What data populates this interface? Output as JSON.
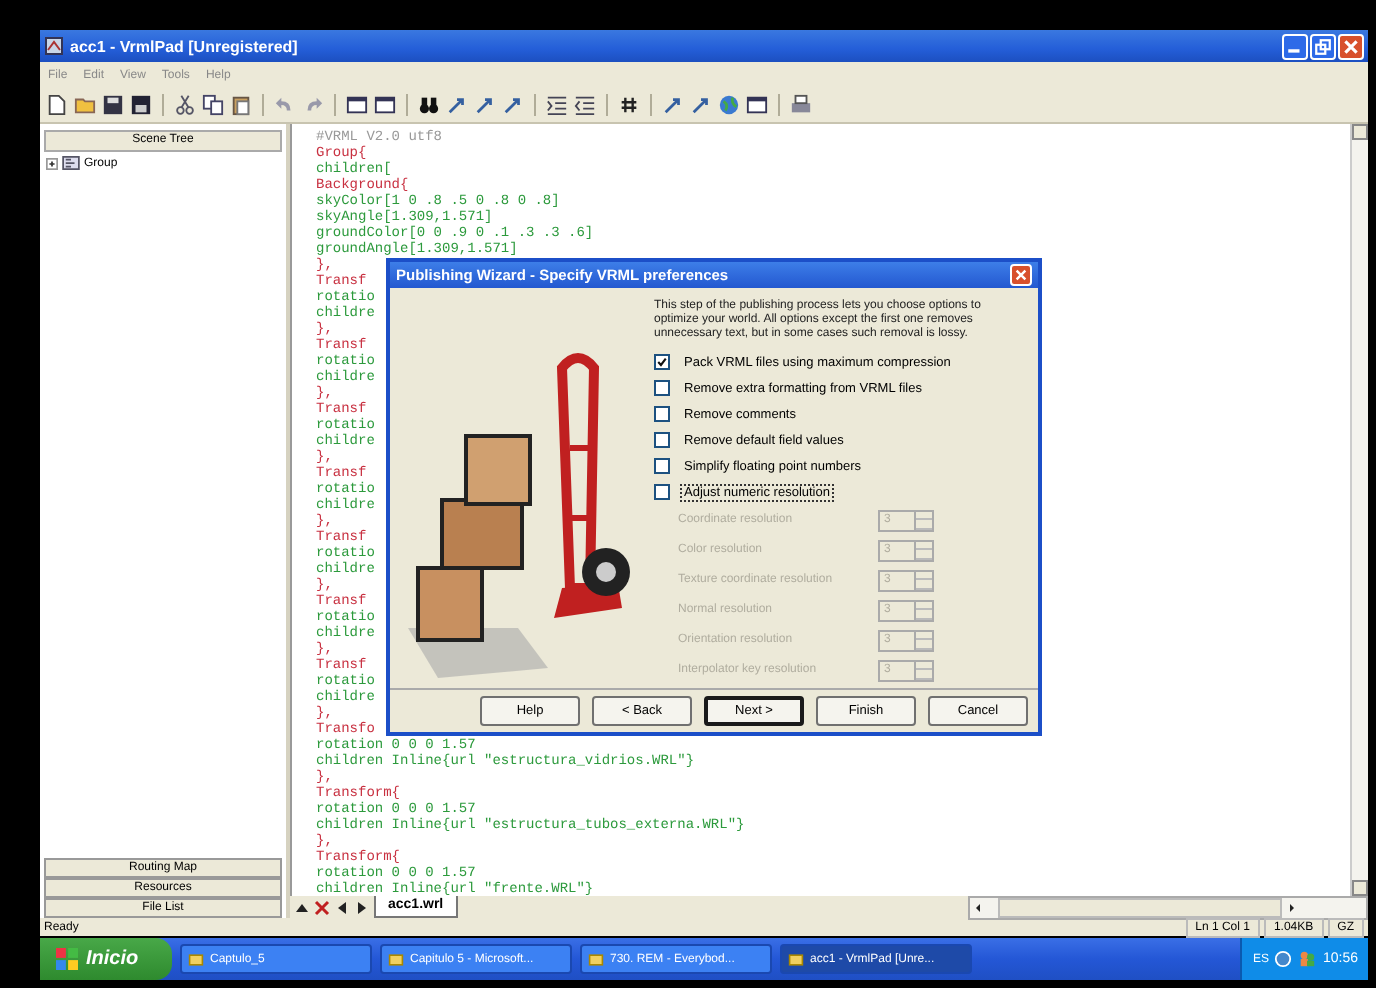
{
  "window": {
    "title": "acc1 - VrmlPad [Unregistered]"
  },
  "menu": [
    "File",
    "Edit",
    "View",
    "Tools",
    "Help"
  ],
  "left_panel": {
    "header": "Scene Tree",
    "tree": [
      {
        "label": "Group",
        "expanded": false
      }
    ],
    "buttons": [
      "Routing Map",
      "Resources",
      "File List"
    ]
  },
  "editor": {
    "lines": [
      {
        "text": "#VRML V2.0 utf8",
        "kind": "comment"
      },
      {
        "text": "Group{",
        "kind": "node"
      },
      {
        "text": "children[",
        "kind": "field"
      },
      {
        "text": "Background{",
        "kind": "node"
      },
      {
        "text": "skyColor[1 0 .8 .5 0 .8 0 .8]",
        "kind": "field"
      },
      {
        "text": "skyAngle[1.309,1.571]",
        "kind": "field"
      },
      {
        "text": "groundColor[0 0 .9 0 .1 .3 .3 .6]",
        "kind": "field"
      },
      {
        "text": "groundAngle[1.309,1.571]",
        "kind": "field"
      },
      {
        "text": "},",
        "kind": "brace"
      },
      {
        "text": "Transf",
        "kind": "node"
      },
      {
        "text": "rotatio",
        "kind": "field"
      },
      {
        "text": "childre",
        "kind": "field"
      },
      {
        "text": "},",
        "kind": "brace"
      },
      {
        "text": "Transf",
        "kind": "node"
      },
      {
        "text": "rotatio",
        "kind": "field"
      },
      {
        "text": "childre",
        "kind": "field"
      },
      {
        "text": "},",
        "kind": "brace"
      },
      {
        "text": "Transf",
        "kind": "node"
      },
      {
        "text": "rotatio",
        "kind": "field"
      },
      {
        "text": "childre",
        "kind": "field"
      },
      {
        "text": "},",
        "kind": "brace"
      },
      {
        "text": "Transf",
        "kind": "node"
      },
      {
        "text": "rotatio",
        "kind": "field"
      },
      {
        "text": "childre",
        "kind": "field"
      },
      {
        "text": "},",
        "kind": "brace"
      },
      {
        "text": "Transf",
        "kind": "node"
      },
      {
        "text": "rotatio",
        "kind": "field"
      },
      {
        "text": "childre",
        "kind": "field"
      },
      {
        "text": "},",
        "kind": "brace"
      },
      {
        "text": "Transf",
        "kind": "node"
      },
      {
        "text": "rotatio",
        "kind": "field"
      },
      {
        "text": "childre",
        "kind": "field"
      },
      {
        "text": "},",
        "kind": "brace"
      },
      {
        "text": "Transf",
        "kind": "node"
      },
      {
        "text": "rotatio",
        "kind": "field"
      },
      {
        "text": "childre",
        "kind": "field"
      },
      {
        "text": "},",
        "kind": "brace"
      },
      {
        "text": "Transfo",
        "kind": "node"
      },
      {
        "text": "rotation 0 0 0 1.57",
        "kind": "field"
      },
      {
        "text": "children Inline{url \"estructura_vidrios.WRL\"}",
        "kind": "field"
      },
      {
        "text": "},",
        "kind": "brace"
      },
      {
        "text": "Transform{",
        "kind": "node"
      },
      {
        "text": "rotation 0 0 0 1.57",
        "kind": "field"
      },
      {
        "text": "children Inline{url \"estructura_tubos_externa.WRL\"}",
        "kind": "field"
      },
      {
        "text": "},",
        "kind": "brace"
      },
      {
        "text": "Transform{",
        "kind": "node"
      },
      {
        "text": "rotation 0 0 0 1.57",
        "kind": "field"
      },
      {
        "text": "children Inline{url \"frente.WRL\"}",
        "kind": "field"
      }
    ],
    "tabs": [
      {
        "label": "acc1.wrl",
        "selected": true
      }
    ]
  },
  "dialog": {
    "title": "Publishing Wizard - Specify VRML preferences",
    "description": "This step of the publishing process lets you choose options to optimize your world.  All options except the first one removes unnecessary text, but in some cases such removal is lossy.",
    "options": [
      {
        "label": "Pack VRML files using maximum compression",
        "checked": true,
        "focused": false
      },
      {
        "label": "Remove extra formatting from VRML files",
        "checked": false,
        "focused": false
      },
      {
        "label": "Remove comments",
        "checked": false,
        "focused": false
      },
      {
        "label": "Remove default field values",
        "checked": false,
        "focused": false
      },
      {
        "label": "Simplify floating point numbers",
        "checked": false,
        "focused": false
      },
      {
        "label": "Adjust numeric resolution",
        "checked": false,
        "focused": true
      }
    ],
    "resolutions": [
      {
        "label": "Coordinate resolution",
        "value": "3",
        "disabled": true
      },
      {
        "label": "Color resolution",
        "value": "3",
        "disabled": true
      },
      {
        "label": "Texture coordinate resolution",
        "value": "3",
        "disabled": true
      },
      {
        "label": "Normal resolution",
        "value": "3",
        "disabled": true
      },
      {
        "label": "Orientation resolution",
        "value": "3",
        "disabled": true
      },
      {
        "label": "Interpolator key resolution",
        "value": "3",
        "disabled": true
      }
    ],
    "buttons": [
      {
        "label": "Help",
        "default": false
      },
      {
        "label": "< Back",
        "default": false
      },
      {
        "label": "Next >",
        "default": true
      },
      {
        "label": "Finish",
        "default": false
      },
      {
        "label": "Cancel",
        "default": false
      }
    ]
  },
  "status_bar": {
    "message": "Ready",
    "panes": [
      "Ln 1 Col 1",
      "1.04KB",
      "GZ"
    ]
  },
  "taskbar": {
    "start": "Inicio",
    "items": [
      {
        "label": "Captulo_5",
        "selected": false
      },
      {
        "label": "Capitulo 5 - Microsoft...",
        "selected": false
      },
      {
        "label": "730. REM - Everybod...",
        "selected": false
      },
      {
        "label": "acc1 - VrmlPad [Unre...",
        "selected": true
      }
    ],
    "language": "ES",
    "clock": "10:56"
  }
}
